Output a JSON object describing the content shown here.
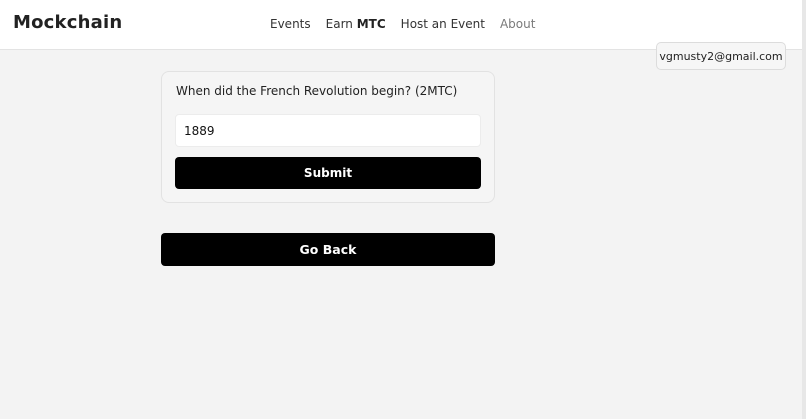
{
  "navbar": {
    "brand": "Mockchain",
    "links": {
      "events": "Events",
      "earn_prefix": "Earn",
      "earn_strong": "MTC",
      "host": "Host an Event",
      "about": "About"
    }
  },
  "account": {
    "email": "vgmusty2@gmail.com"
  },
  "quiz": {
    "question": "When did the French Revolution begin? (2MTC)",
    "answer_value": "1889",
    "submit_label": "Submit"
  },
  "actions": {
    "go_back_label": "Go Back"
  }
}
